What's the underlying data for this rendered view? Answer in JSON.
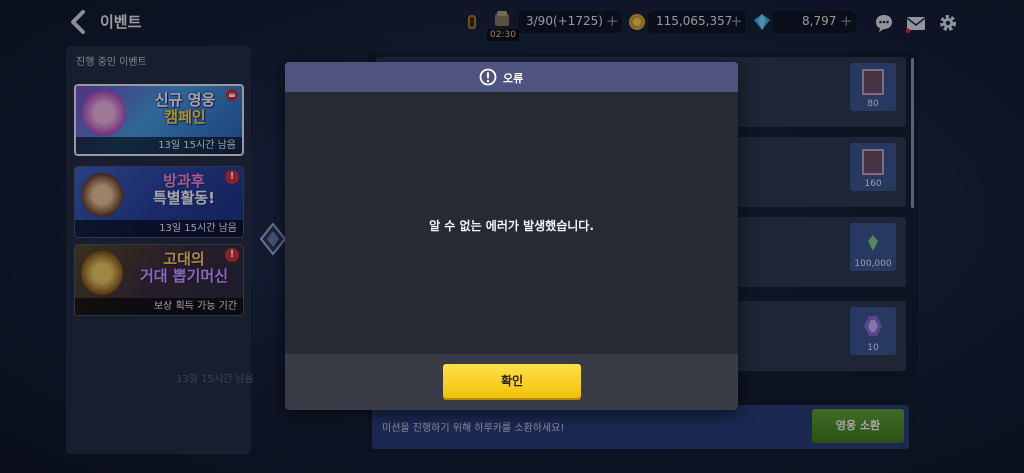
{
  "header": {
    "title": "이벤트",
    "stamina": {
      "value": "3/90(+1725)",
      "timer": "02:30"
    },
    "gold": {
      "value": "115,065,357"
    },
    "gems": {
      "value": "8,797"
    },
    "plus_label": "+"
  },
  "left_panel": {
    "title": "진행 중인 이벤트",
    "banners": [
      {
        "headline_1": "신규 영웅",
        "headline_2": "캠페인",
        "caption": "13일 15시간 남음",
        "badge": ""
      },
      {
        "headline_1": "방과후",
        "headline_2": "특별활동!",
        "caption": "13일 15시간 남음",
        "badge": "!"
      },
      {
        "headline_1": "고대의",
        "headline_2": "거대 뽑기머신",
        "caption": "보상 획득 가능 기간",
        "badge": "!"
      }
    ]
  },
  "main": {
    "rewards": [
      "80",
      "160",
      "100,000",
      "10"
    ],
    "bottom_hint": "미션을 진행하기 위해 하루카를 소환하세요!",
    "summon_button": "영웅 소환",
    "bg_countdown": "13일 15시간 남음"
  },
  "dialog": {
    "title": "오류",
    "message": "알 수 없는 에러가 발생했습니다.",
    "confirm_label": "확인"
  },
  "colors": {
    "dialog_header": "#4f5380",
    "confirm_button": "#f2c20a",
    "summon_button": "#4f922c",
    "badge_red": "#d8323c"
  }
}
